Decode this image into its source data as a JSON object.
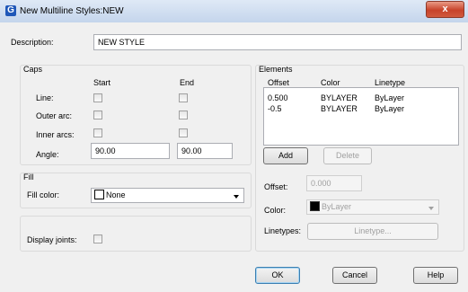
{
  "window": {
    "title": "New Multiline Styles:NEW",
    "app_icon_letter": "G",
    "close_glyph": "x"
  },
  "description": {
    "label": "Description:",
    "value": "NEW STYLE"
  },
  "caps": {
    "title": "Caps",
    "start_header": "Start",
    "end_header": "End",
    "line_label": "Line:",
    "outer_arc_label": "Outer arc:",
    "inner_arcs_label": "Inner arcs:",
    "angle_label": "Angle:",
    "angle_start": "90.00",
    "angle_end": "90.00"
  },
  "fill": {
    "title": "Fill",
    "color_label": "Fill color:",
    "color_value": "None"
  },
  "display_joints": {
    "label": "Display joints:"
  },
  "elements": {
    "title": "Elements",
    "headers": {
      "offset": "Offset",
      "color": "Color",
      "linetype": "Linetype"
    },
    "rows": [
      {
        "offset": "0.500",
        "color": "BYLAYER",
        "linetype": "ByLayer"
      },
      {
        "offset": "-0.5",
        "color": "BYLAYER",
        "linetype": "ByLayer"
      }
    ],
    "add_label": "Add",
    "delete_label": "Delete",
    "offset_label": "Offset:",
    "offset_value": "0.000",
    "color_label": "Color:",
    "color_value": "ByLayer",
    "linetypes_label": "Linetypes:",
    "linetype_button": "Linetype..."
  },
  "buttons": {
    "ok": "OK",
    "cancel": "Cancel",
    "help": "Help"
  },
  "colors": {
    "accent": "#3c7fb1",
    "close": "#c7432a"
  }
}
